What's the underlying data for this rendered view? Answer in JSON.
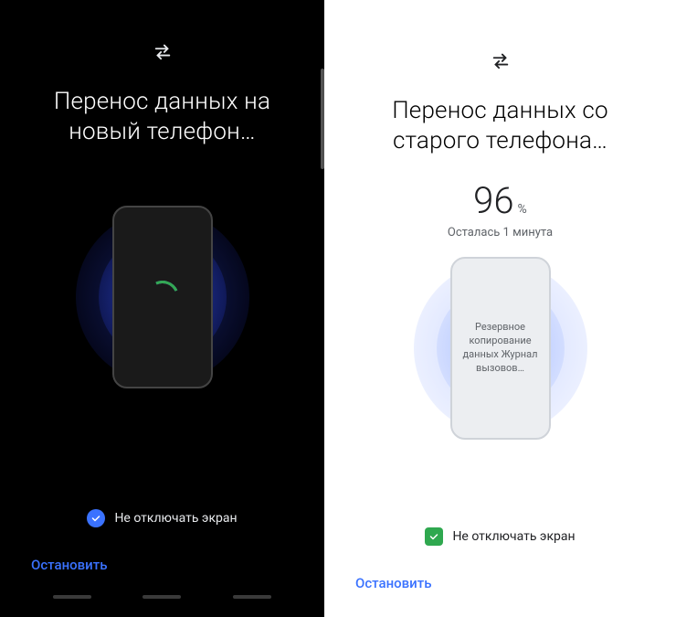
{
  "left": {
    "title": "Перенос данных на новый телефон…",
    "checkbox_label": "Не отключать экран",
    "stop_label": "Остановить"
  },
  "right": {
    "title": "Перенос данных со старого телефона…",
    "progress_value": "96",
    "progress_unit": "%",
    "time_remaining": "Осталась 1 минута",
    "phone_status": "Резервное копирование данных Журнал вызовов…",
    "checkbox_label": "Не отключать экран",
    "stop_label": "Остановить"
  },
  "icons": {
    "transfer": "transfer-arrows"
  },
  "colors": {
    "accent_blue": "#3a72ff",
    "accent_green": "#2fa84f"
  }
}
